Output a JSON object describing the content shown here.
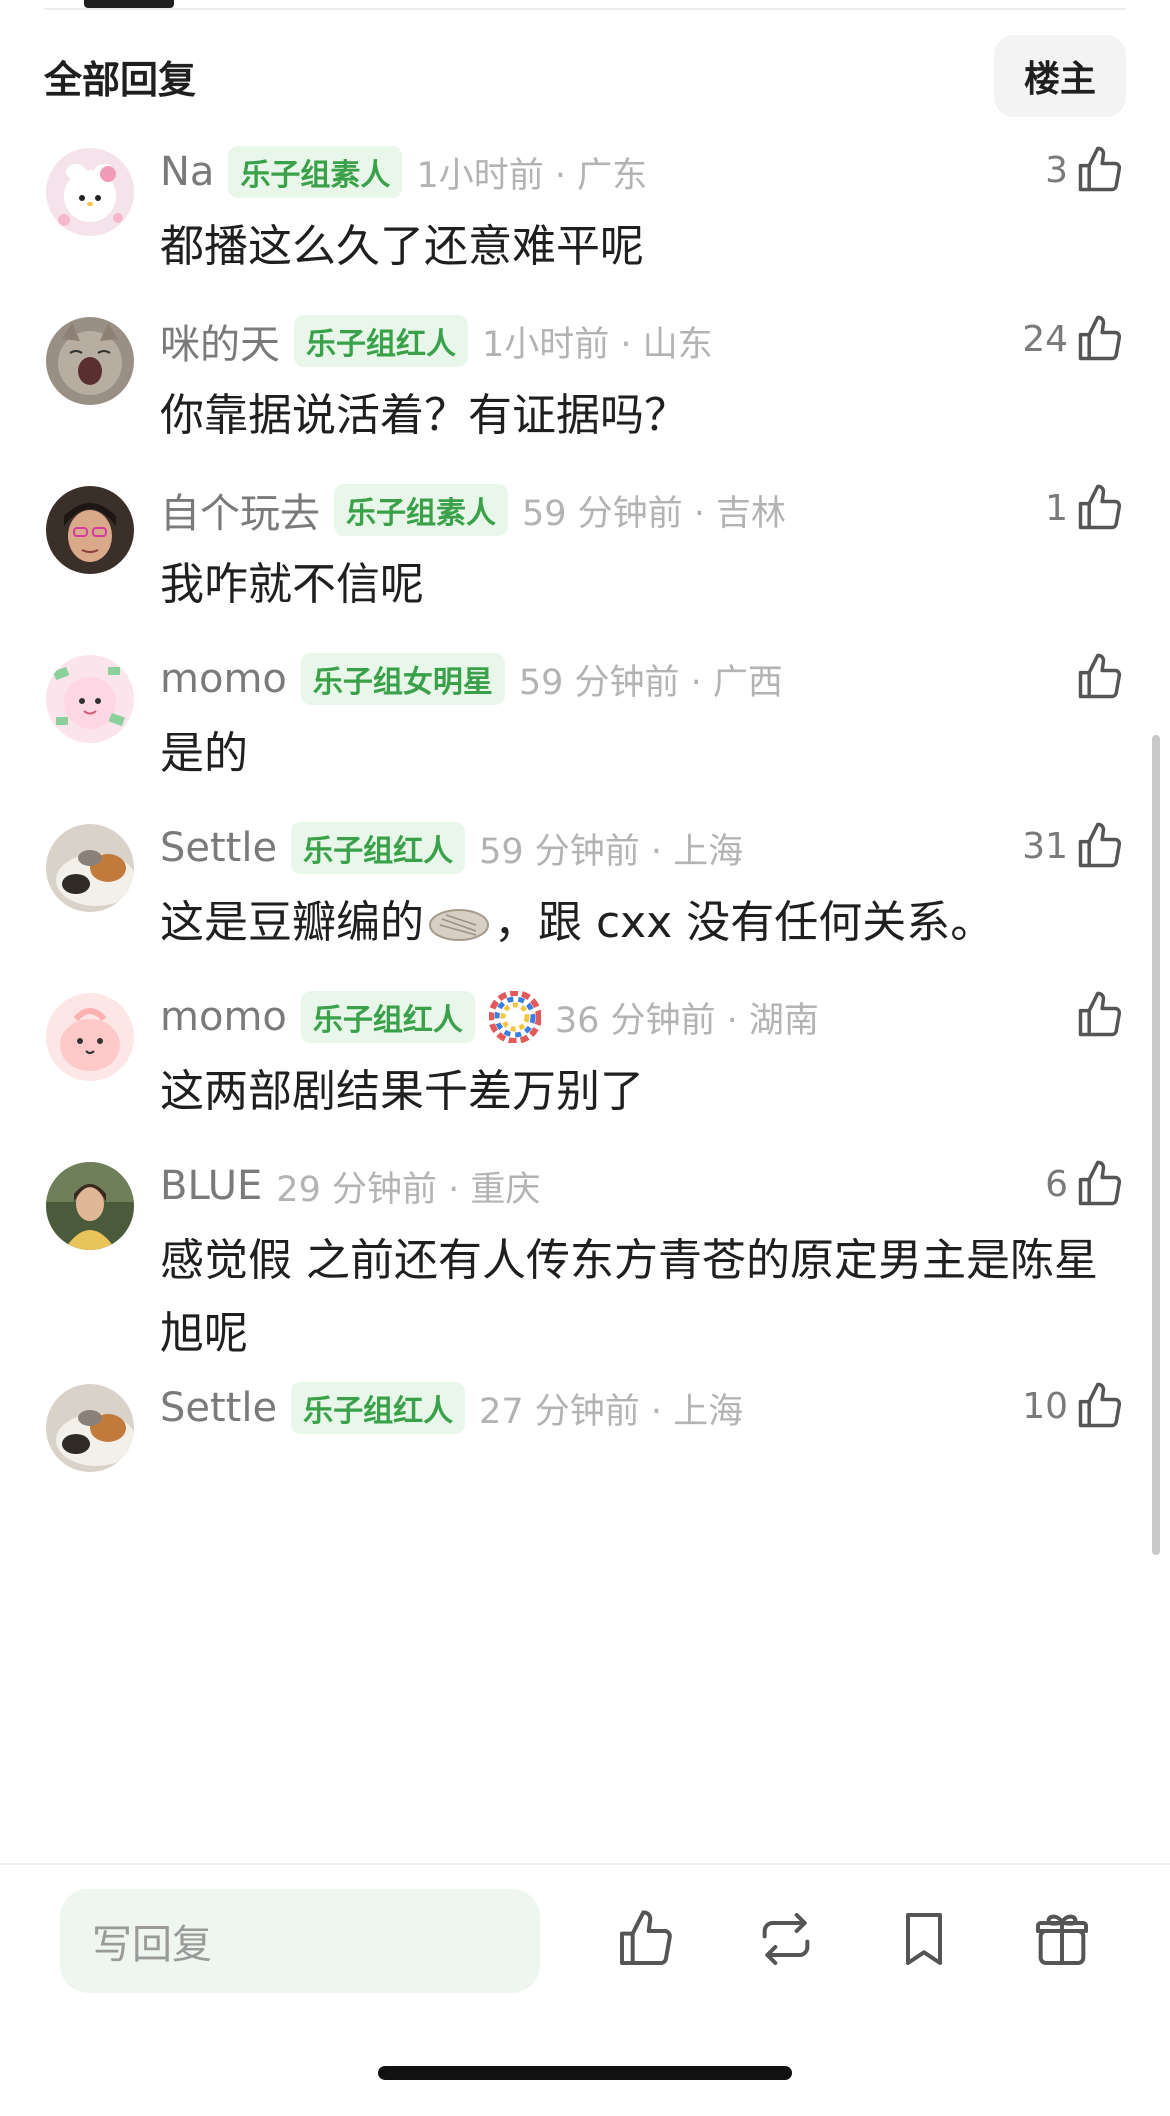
{
  "header": {
    "title": "全部回复",
    "op_toggle": "楼主"
  },
  "comments": [
    {
      "user": "Na",
      "badge": "乐子组素人",
      "time_loc": "1小时前 · 广东",
      "likes": "3",
      "text": "都播这么久了还意难平呢",
      "avatar": "hello-kitty-avatar"
    },
    {
      "user": "咪的天",
      "badge": "乐子组红人",
      "time_loc": "1小时前 · 山东",
      "likes": "24",
      "text": "你靠据说活着？有证据吗？",
      "avatar": "yawning-cat-avatar"
    },
    {
      "user": "自个玩去",
      "badge": "乐子组素人",
      "time_loc": "59 分钟前 · 吉林",
      "likes": "1",
      "text": "我咋就不信呢",
      "avatar": "woman-glasses-avatar"
    },
    {
      "user": "momo",
      "badge": "乐子组女明星",
      "time_loc": "59 分钟前 · 广西",
      "likes": "",
      "text": "是的",
      "avatar": "pink-cartoon-avatar"
    },
    {
      "user": "Settle",
      "badge": "乐子组红人",
      "time_loc": "59 分钟前 · 上海",
      "likes": "31",
      "text_before": "这是豆瓣编的",
      "text_after": "，跟 cxx 没有任何关系。",
      "avatar": "calico-cat-avatar"
    },
    {
      "user": "momo",
      "badge": "乐子组红人",
      "time_loc": "36 分钟前 · 湖南",
      "likes": "",
      "text": "这两部剧结果千差万别了",
      "avatar": "pink-blob-avatar"
    },
    {
      "user": "BLUE",
      "badge": "",
      "time_loc": "29 分钟前 · 重庆",
      "likes": "6",
      "text": "感觉假 之前还有人传东方青苍的原定男主是陈星旭呢",
      "avatar": "woman-photo-avatar"
    },
    {
      "user": "Settle",
      "badge": "乐子组红人",
      "time_loc": "27 分钟前 · 上海",
      "likes": "10",
      "text": "",
      "avatar": "calico-cat-avatar"
    }
  ],
  "bottom_bar": {
    "reply_placeholder": "写回复",
    "icons": [
      "thumbs-up-icon",
      "repost-icon",
      "bookmark-icon",
      "gift-icon"
    ]
  },
  "colors": {
    "badge_green": "#3aa14a",
    "badge_bg": "#e8f7ea",
    "input_bg": "#eef6ef"
  }
}
